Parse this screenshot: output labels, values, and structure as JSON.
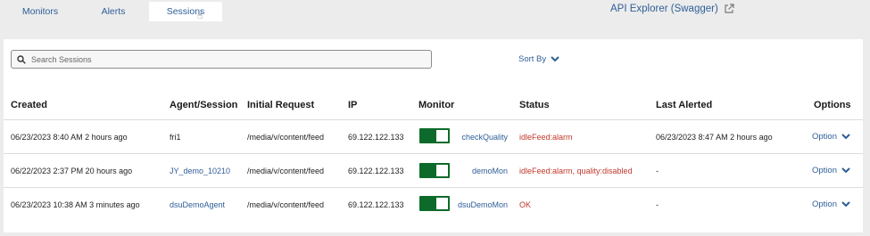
{
  "nav": {
    "tabs": [
      {
        "label": "Monitors"
      },
      {
        "label": "Alerts"
      },
      {
        "label": "Sessions"
      }
    ],
    "api_link": "API Explorer (Swagger)"
  },
  "search": {
    "placeholder": "Search Sessions",
    "value": ""
  },
  "sort": {
    "label": "Sort By"
  },
  "table": {
    "headers": [
      "Created",
      "Agent/Session",
      "Initial Request",
      "IP",
      "Monitor",
      "Status",
      "Last Alerted",
      "Options"
    ],
    "rows": [
      {
        "created": "06/23/2023 8:40 AM 2 hours ago",
        "agent": "fri1",
        "initial_request": "/media/v/content/feed",
        "ip": "69.122.122.133",
        "monitor_enabled": true,
        "monitor": "checkQuality",
        "status": "idleFeed:alarm",
        "last_alerted": "06/23/2023 8:47 AM 2 hours ago",
        "options": "Option"
      },
      {
        "created": "06/22/2023 2:37 PM 20 hours ago",
        "agent": "JY_demo_10210",
        "initial_request": "/media/v/content/feed",
        "ip": "69.122.122.133",
        "monitor_enabled": true,
        "monitor": "demoMon",
        "status": "idleFeed:alarm, quality:disabled",
        "last_alerted": "-",
        "options": "Option"
      },
      {
        "created": "06/23/2023 10:38 AM 3 minutes ago",
        "agent": "dsuDemoAgent",
        "initial_request": "/media/v/content/feed",
        "ip": "69.122.122.133",
        "monitor_enabled": true,
        "monitor": "dsuDemoMon",
        "status": "OK",
        "last_alerted": "-",
        "options": "Option"
      }
    ]
  },
  "colors": {
    "accent": "#2f5e98",
    "status_alert": "#c0392b",
    "toggle_on": "#0c6b2a"
  }
}
